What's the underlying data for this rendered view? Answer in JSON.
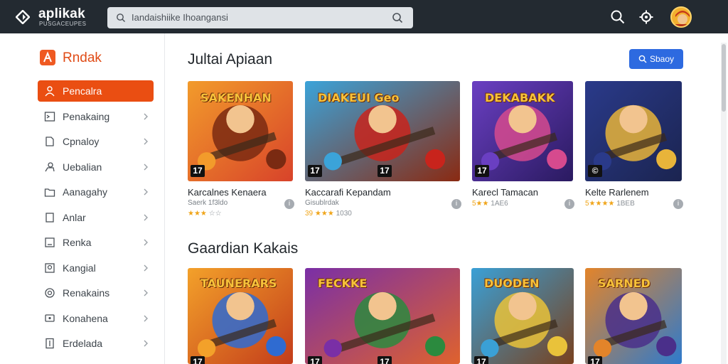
{
  "header": {
    "brand": "aplikak",
    "brand_sub": "PUSGACEUPES",
    "search_placeholder": "Iandaishiike Ihoangansi",
    "icons": [
      "search-icon",
      "settings-icon"
    ]
  },
  "sidebar": {
    "title": "Rndak",
    "items": [
      {
        "label": "Pencalra",
        "icon": "user-icon",
        "active": true
      },
      {
        "label": "Penakaing",
        "icon": "terminal-icon"
      },
      {
        "label": "Cpnaloy",
        "icon": "doc-icon"
      },
      {
        "label": "Uebalian",
        "icon": "person-icon"
      },
      {
        "label": "Aanagahy",
        "icon": "folder-icon"
      },
      {
        "label": "Anlar",
        "icon": "page-icon"
      },
      {
        "label": "Renka",
        "icon": "box-icon"
      },
      {
        "label": "Kangial",
        "icon": "image-icon"
      },
      {
        "label": "Renakains",
        "icon": "circle-icon"
      },
      {
        "label": "Konahena",
        "icon": "chat-icon"
      },
      {
        "label": "Erdelada",
        "icon": "file-icon"
      }
    ]
  },
  "main": {
    "section1_title": "Jultai Apiaan",
    "view_button": "Sbaoy",
    "section2_title": "Gaardian Kakais",
    "row1": [
      {
        "art_title": "SAKENHAN",
        "age": "17",
        "name": "Karcalnes Kenaera",
        "sub": "Saerk 1f3ldo",
        "rating_stars": "★★★",
        "rating_text": "☆☆"
      },
      {
        "art_title": "DIAKEUI Geo",
        "age": "17",
        "age2": "17",
        "name": "Kaccarafi Kepandam",
        "sub": "Gisublrdak",
        "rating_stars": "39 ★★★",
        "rating_text": "1030"
      },
      {
        "art_title": "DEKABAKK",
        "age": "17",
        "name": "Karecl Tamacan",
        "sub": "",
        "rating_stars": "5★★",
        "rating_text": "1AE6"
      },
      {
        "art_title": "",
        "age": "©",
        "name": "Kelte Rarlenem",
        "sub": "",
        "rating_stars": "5★★★★",
        "rating_text": "1BEB"
      }
    ],
    "row2": [
      {
        "art_title": "TAUNERARS",
        "age": "17"
      },
      {
        "art_title": "FECKKE",
        "age": "17",
        "age2": "17"
      },
      {
        "art_title": "DUODEN",
        "age": "17"
      },
      {
        "art_title": "SARNED",
        "age": "17"
      }
    ]
  },
  "colors": {
    "topbar": "#232a31",
    "accent": "#ea4e12",
    "button": "#2d6ae0"
  }
}
